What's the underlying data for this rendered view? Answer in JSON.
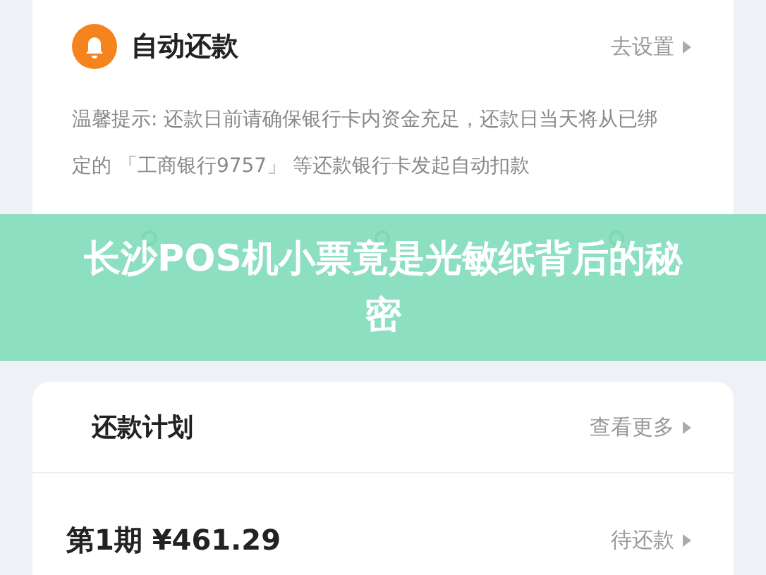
{
  "auto_repay": {
    "title": "自动还款",
    "action": "去设置",
    "tip": "温馨提示: 还款日前请确保银行卡内资金充足，还款日当天将从已绑定的 「工商银行9757」 等还款银行卡发起自动扣款"
  },
  "banner": {
    "title": "长沙POS机小票竟是光敏纸背后的秘密"
  },
  "plan": {
    "title": "还款计划",
    "action": "查看更多",
    "installments": [
      {
        "period": "第1期",
        "amount": "¥461.29",
        "status": "待还款"
      }
    ]
  }
}
